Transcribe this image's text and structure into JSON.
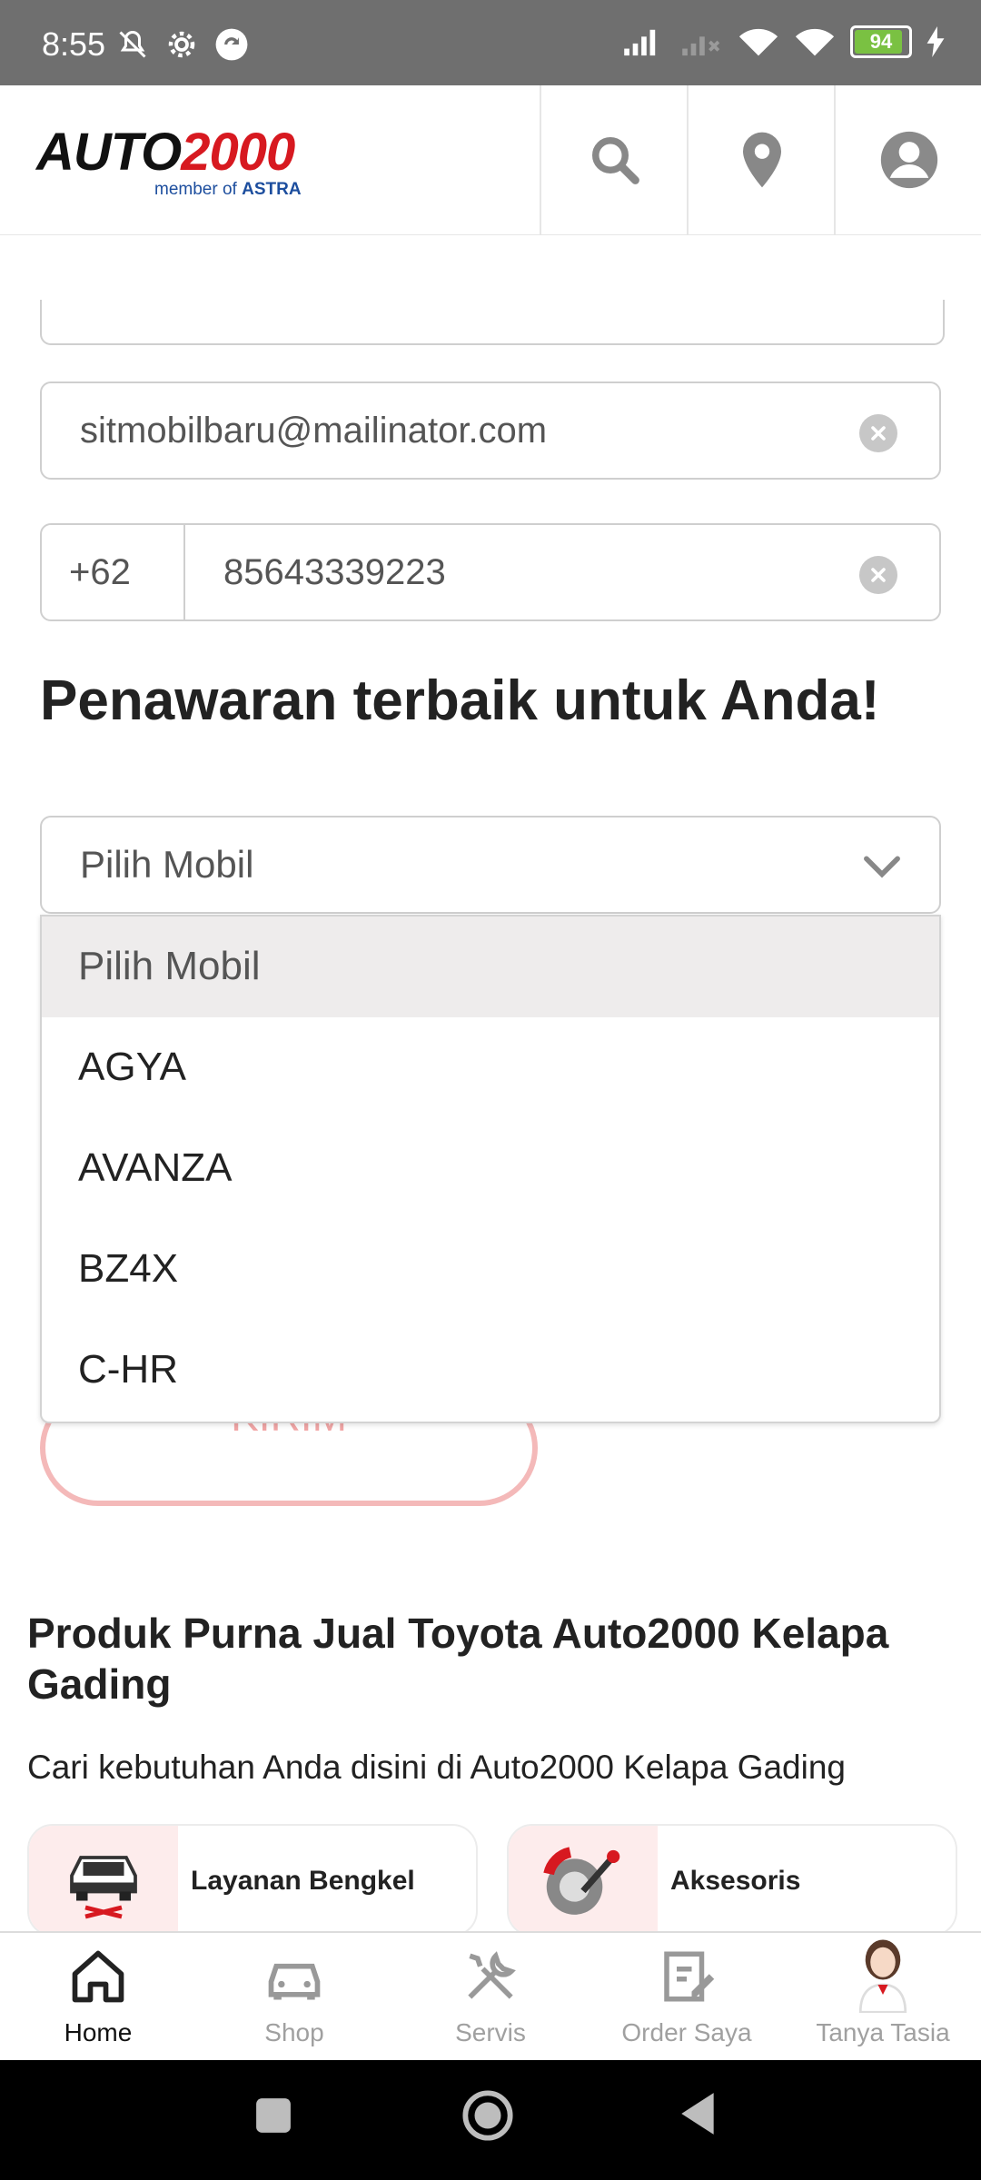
{
  "status_bar": {
    "time": "8:55",
    "battery": "94",
    "icons": [
      "mute-icon",
      "settings-icon",
      "sync-icon",
      "signal-icon",
      "signal-x-icon",
      "wifi-plus-icon",
      "wifi-icon",
      "battery-icon",
      "charging-icon"
    ]
  },
  "header": {
    "logo_auto": "AUTO",
    "logo_num": "2000",
    "logo_member": "member of ",
    "logo_astra": "ASTRA",
    "actions": [
      "search-icon",
      "location-pin-icon",
      "user-account-icon"
    ]
  },
  "form": {
    "email": "sitmobilbaru@mailinator.com",
    "phone_prefix": "+62",
    "phone": "85643339223",
    "offer_title": "Penawaran terbaik untuk Anda!",
    "car_select": {
      "value": "Pilih Mobil",
      "options": [
        "Pilih Mobil",
        "AGYA",
        "AVANZA",
        "BZ4X",
        "C-HR"
      ]
    },
    "submit_label": "KIRIM"
  },
  "aftersales": {
    "title": "Produk Purna Jual Toyota Auto2000 Kelapa Gading",
    "subtitle": "Cari kebutuhan Anda disini di Auto2000 Kelapa Gading",
    "cards": [
      {
        "label": "Layanan Bengkel",
        "icon": "car-lift-icon"
      },
      {
        "label": "Aksesoris",
        "icon": "brake-accessory-icon"
      }
    ]
  },
  "bottom_nav": {
    "items": [
      {
        "label": "Home",
        "icon": "home-icon",
        "active": true
      },
      {
        "label": "Shop",
        "icon": "car-icon",
        "active": false
      },
      {
        "label": "Servis",
        "icon": "tools-icon",
        "active": false
      },
      {
        "label": "Order Saya",
        "icon": "order-clipboard-icon",
        "active": false
      },
      {
        "label": "Tanya Tasia",
        "icon": "assistant-avatar-icon",
        "active": false
      }
    ]
  },
  "colors": {
    "brand_red": "#d71920",
    "brand_blue": "#1d4e9e",
    "kirim_border": "#f4b9b9"
  }
}
